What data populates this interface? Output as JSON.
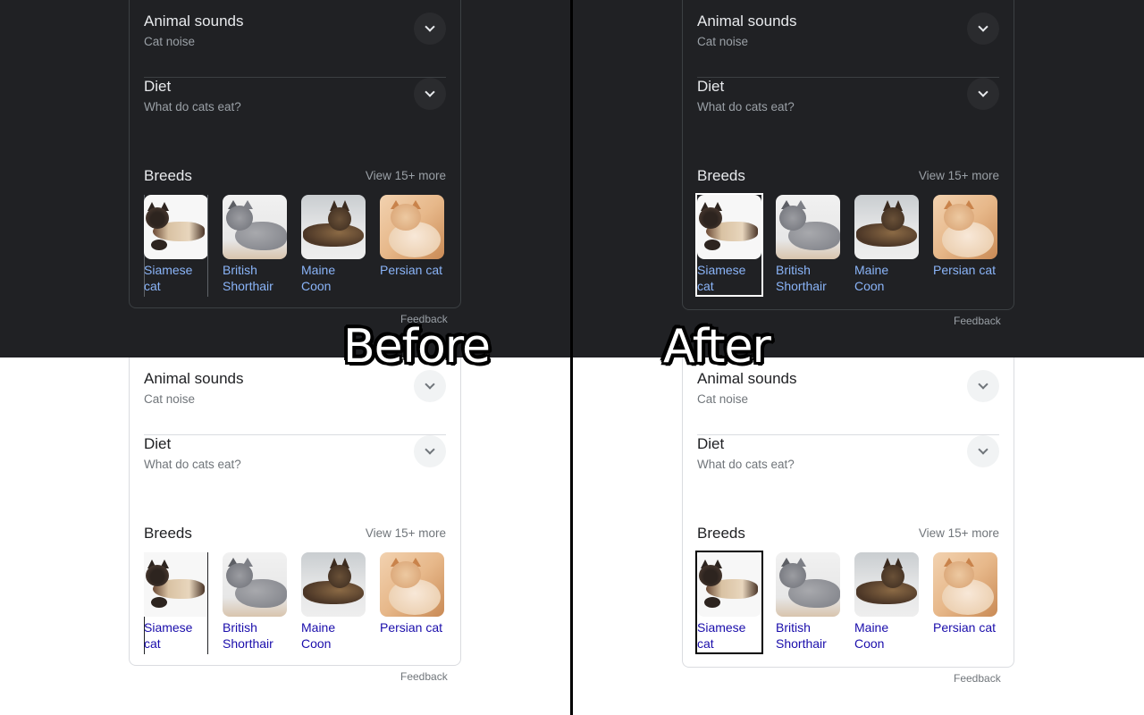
{
  "labels": {
    "before": "Before",
    "after": "After"
  },
  "panel": {
    "rows": [
      {
        "title": "Animal sounds",
        "subtitle": "Cat noise"
      },
      {
        "title": "Diet",
        "subtitle": "What do cats eat?"
      }
    ],
    "breeds_title": "Breeds",
    "view_more": "View 15+ more",
    "breeds": [
      {
        "name_line1": "Siamese",
        "name_line2": "cat"
      },
      {
        "name_line1": "British",
        "name_line2": "Shorthair"
      },
      {
        "name_line1": "Maine",
        "name_line2": "Coon"
      },
      {
        "name_line1": "Persian cat",
        "name_line2": ""
      }
    ],
    "feedback": "Feedback"
  },
  "colors": {
    "dark_bg": "#202124",
    "light_bg": "#ffffff",
    "dark_link": "#8ab4f8",
    "light_link": "#1a0dab"
  }
}
